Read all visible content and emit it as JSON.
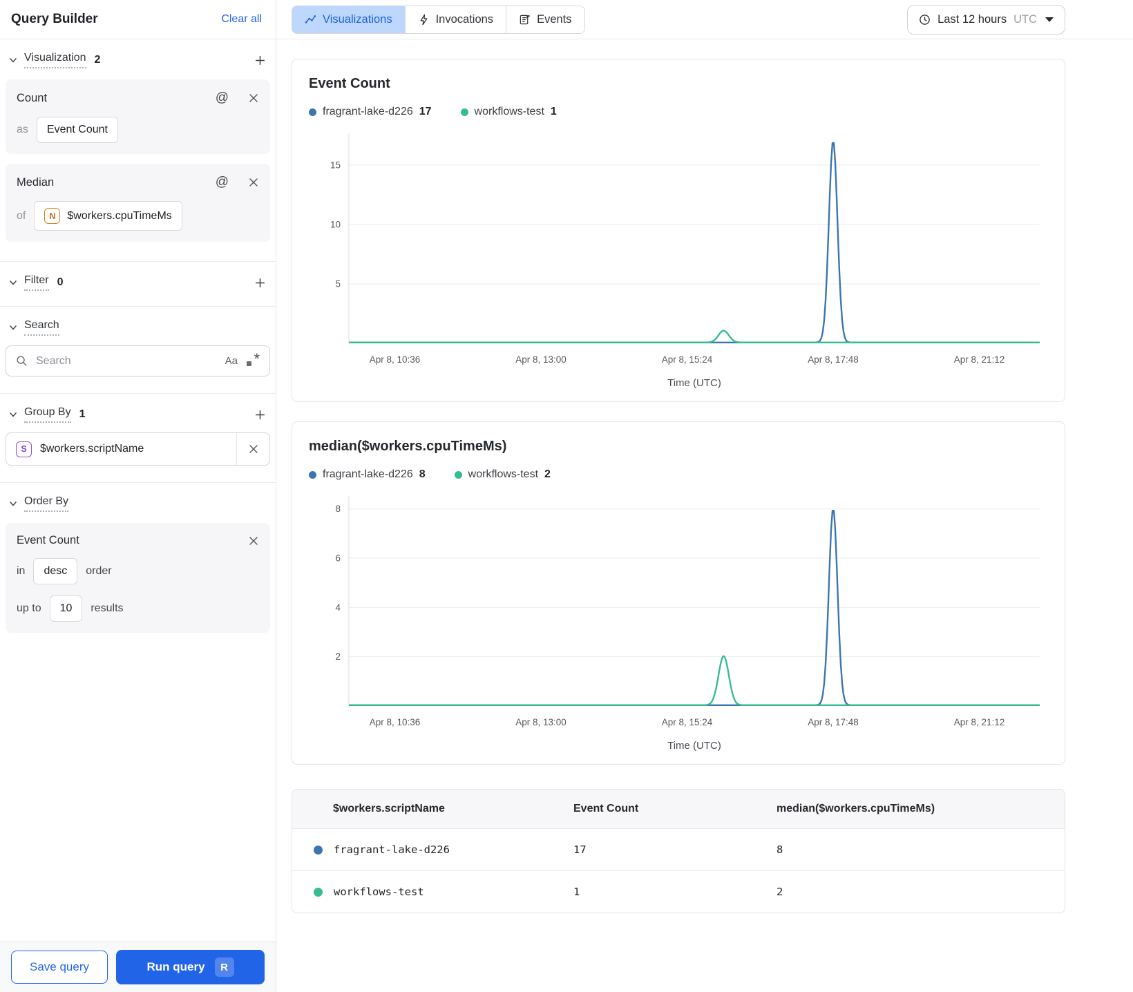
{
  "colors": {
    "accent": "#2264e8",
    "series_blue": "#3B76AF",
    "series_green": "#35BD8E"
  },
  "sidebar": {
    "title": "Query Builder",
    "clear_all": "Clear all",
    "at_icon": "@",
    "visualization": {
      "label": "Visualization",
      "count": "2"
    },
    "count_card": {
      "title": "Count",
      "as_label": "as",
      "value": "Event Count"
    },
    "median_card": {
      "title": "Median",
      "of_label": "of",
      "badge": "N",
      "value": "$workers.cpuTimeMs"
    },
    "filter": {
      "label": "Filter",
      "count": "0"
    },
    "search": {
      "label": "Search",
      "placeholder": "Search",
      "case_icon": "Aa",
      "regex_asterisk": "*"
    },
    "group_by": {
      "label": "Group By",
      "count": "1",
      "item": {
        "badge": "S",
        "value": "$workers.scriptName"
      }
    },
    "order_by": {
      "label": "Order By",
      "card": {
        "title": "Event Count",
        "in_label": "in",
        "direction": "desc",
        "order_label": "order",
        "up_to_label": "up to",
        "limit": "10",
        "results_label": "results"
      }
    },
    "save_button": "Save query",
    "run_button": "Run query",
    "run_shortcut": "R"
  },
  "header": {
    "tabs": [
      {
        "label": "Visualizations",
        "active": true
      },
      {
        "label": "Invocations",
        "active": false
      },
      {
        "label": "Events",
        "active": false
      }
    ],
    "time_range": {
      "label": "Last 12 hours",
      "zone": "UTC"
    }
  },
  "chart_data": [
    {
      "type": "line",
      "title": "Event Count",
      "xlabel": "Time (UTC)",
      "x_ticks": [
        "Apr 8, 10:36",
        "Apr 8, 13:00",
        "Apr 8, 15:24",
        "Apr 8, 17:48",
        "Apr 8, 21:12"
      ],
      "y_ticks": [
        5,
        10,
        15
      ],
      "ylim": [
        0,
        17.2
      ],
      "grid": true,
      "legend_position": "top",
      "legend": [
        {
          "name": "fragrant-lake-d226",
          "value": 17,
          "color": "#3B76AF"
        },
        {
          "name": "workflows-test",
          "value": 1,
          "color": "#35BD8E"
        }
      ],
      "series": [
        {
          "name": "fragrant-lake-d226",
          "color": "#3B76AF",
          "baseline": 0,
          "peaks": [
            {
              "x_frac": 0.701,
              "value": 17,
              "sigma": 0.0062,
              "time": "Apr 8, 17:48"
            }
          ]
        },
        {
          "name": "workflows-test",
          "color": "#35BD8E",
          "baseline": 0,
          "peaks": [
            {
              "x_frac": 0.5425,
              "value": 1,
              "sigma": 0.0075,
              "time": "~Apr 8, 15:40"
            }
          ]
        }
      ]
    },
    {
      "type": "line",
      "title": "median($workers.cpuTimeMs)",
      "xlabel": "Time (UTC)",
      "x_ticks": [
        "Apr 8, 10:36",
        "Apr 8, 13:00",
        "Apr 8, 15:24",
        "Apr 8, 17:48",
        "Apr 8, 21:12"
      ],
      "y_ticks": [
        2,
        4,
        6,
        8
      ],
      "ylim": [
        0,
        8.3
      ],
      "grid": true,
      "legend_position": "top",
      "legend": [
        {
          "name": "fragrant-lake-d226",
          "value": 8,
          "color": "#3B76AF"
        },
        {
          "name": "workflows-test",
          "value": 2,
          "color": "#35BD8E"
        }
      ],
      "series": [
        {
          "name": "fragrant-lake-d226",
          "color": "#3B76AF",
          "baseline": 0,
          "peaks": [
            {
              "x_frac": 0.701,
              "value": 8,
              "sigma": 0.0062,
              "time": "Apr 8, 17:48"
            }
          ]
        },
        {
          "name": "workflows-test",
          "color": "#35BD8E",
          "baseline": 0,
          "peaks": [
            {
              "x_frac": 0.5425,
              "value": 2,
              "sigma": 0.0075,
              "time": "~Apr 8, 15:40"
            }
          ]
        }
      ]
    }
  ],
  "table": {
    "columns": [
      "$workers.scriptName",
      "Event Count",
      "median($workers.cpuTimeMs)"
    ],
    "rows": [
      {
        "color": "#3B76AF",
        "name": "fragrant-lake-d226",
        "values": [
          "17",
          "8"
        ]
      },
      {
        "color": "#35BD8E",
        "name": "workflows-test",
        "values": [
          "1",
          "2"
        ]
      }
    ]
  }
}
